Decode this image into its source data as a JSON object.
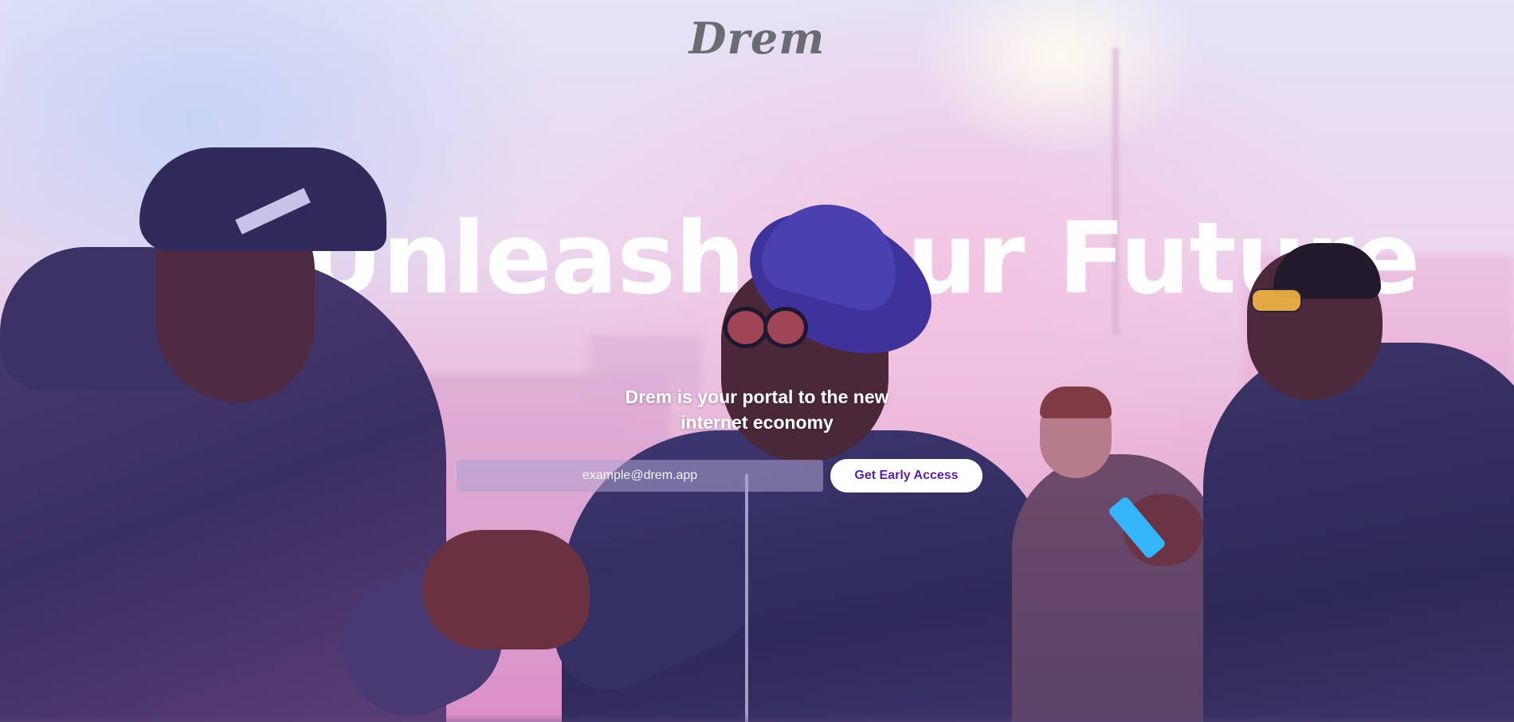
{
  "brand": {
    "logo_text": "Drem"
  },
  "hero": {
    "headline": "Unleash Your Future",
    "tagline_line1": "Drem is your portal to the new",
    "tagline_line2": "internet economy",
    "background_image": "people-in-pink-smoke-photo"
  },
  "signup": {
    "email_placeholder": "example@drem.app",
    "email_value": "",
    "cta_label": "Get Early Access"
  },
  "colors": {
    "cta_text": "#5a1fa0",
    "cta_background": "#ffffff",
    "logo": "#6b6b72",
    "headline": "#ffffff"
  }
}
